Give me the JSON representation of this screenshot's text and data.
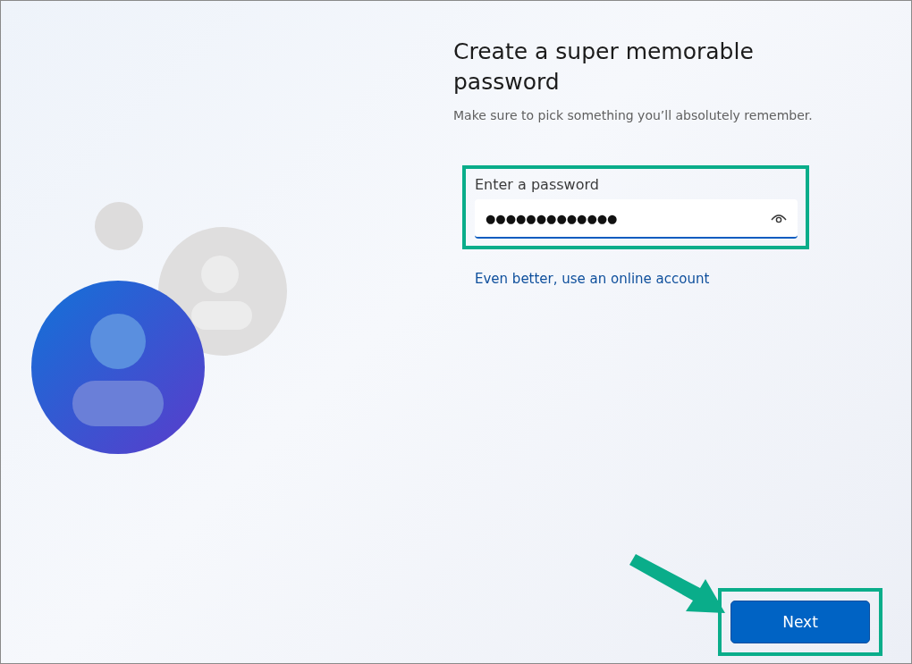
{
  "title": "Create a super memorable password",
  "subtitle": "Make sure to pick something you’ll absolutely remember.",
  "password_field": {
    "label": "Enter a password",
    "value": "●●●●●●●●●●●●●",
    "highlighted": true
  },
  "link": "Even better, use an online account",
  "next_button": {
    "label": "Next",
    "highlighted": true
  }
}
